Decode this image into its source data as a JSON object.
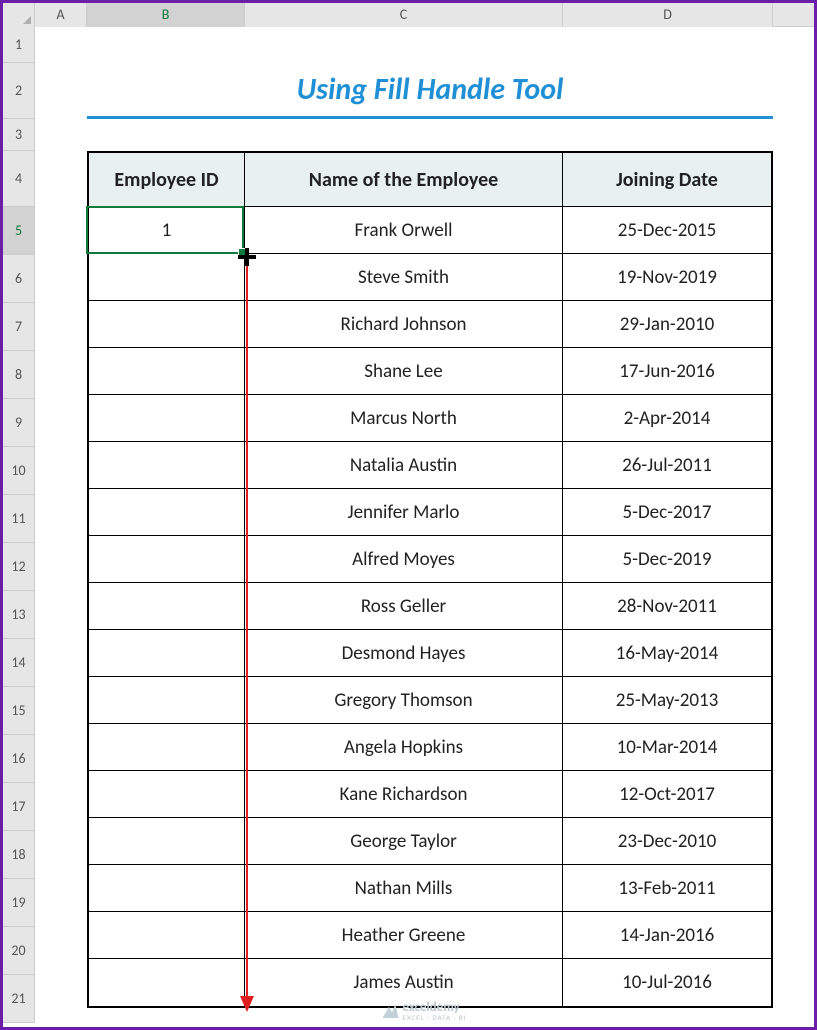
{
  "columns": [
    "A",
    "B",
    "C",
    "D"
  ],
  "active_column": "B",
  "rows": [
    "1",
    "2",
    "3",
    "4",
    "5",
    "6",
    "7",
    "8",
    "9",
    "10",
    "11",
    "12",
    "13",
    "14",
    "15",
    "16",
    "17",
    "18",
    "19",
    "20",
    "21"
  ],
  "active_row": "5",
  "title": "Using Fill Handle Tool",
  "table": {
    "headers": {
      "id": "Employee ID",
      "name": "Name of the Employee",
      "date": "Joining Date"
    },
    "rows": [
      {
        "id": "1",
        "name": "Frank Orwell",
        "date": "25-Dec-2015"
      },
      {
        "id": "",
        "name": "Steve Smith",
        "date": "19-Nov-2019"
      },
      {
        "id": "",
        "name": "Richard Johnson",
        "date": "29-Jan-2010"
      },
      {
        "id": "",
        "name": "Shane Lee",
        "date": "17-Jun-2016"
      },
      {
        "id": "",
        "name": "Marcus North",
        "date": "2-Apr-2014"
      },
      {
        "id": "",
        "name": "Natalia Austin",
        "date": "26-Jul-2011"
      },
      {
        "id": "",
        "name": "Jennifer Marlo",
        "date": "5-Dec-2017"
      },
      {
        "id": "",
        "name": "Alfred Moyes",
        "date": "5-Dec-2019"
      },
      {
        "id": "",
        "name": "Ross Geller",
        "date": "28-Nov-2011"
      },
      {
        "id": "",
        "name": "Desmond Hayes",
        "date": "16-May-2014"
      },
      {
        "id": "",
        "name": "Gregory Thomson",
        "date": "25-May-2013"
      },
      {
        "id": "",
        "name": "Angela Hopkins",
        "date": "10-Mar-2014"
      },
      {
        "id": "",
        "name": "Kane Richardson",
        "date": "12-Oct-2017"
      },
      {
        "id": "",
        "name": "George Taylor",
        "date": "23-Dec-2010"
      },
      {
        "id": "",
        "name": "Nathan Mills",
        "date": "13-Feb-2011"
      },
      {
        "id": "",
        "name": "Heather Greene",
        "date": "14-Jan-2016"
      },
      {
        "id": "",
        "name": "James Austin",
        "date": "10-Jul-2016"
      }
    ]
  },
  "watermark": {
    "brand": "exceldemy",
    "tagline": "EXCEL · DATA · BI"
  }
}
